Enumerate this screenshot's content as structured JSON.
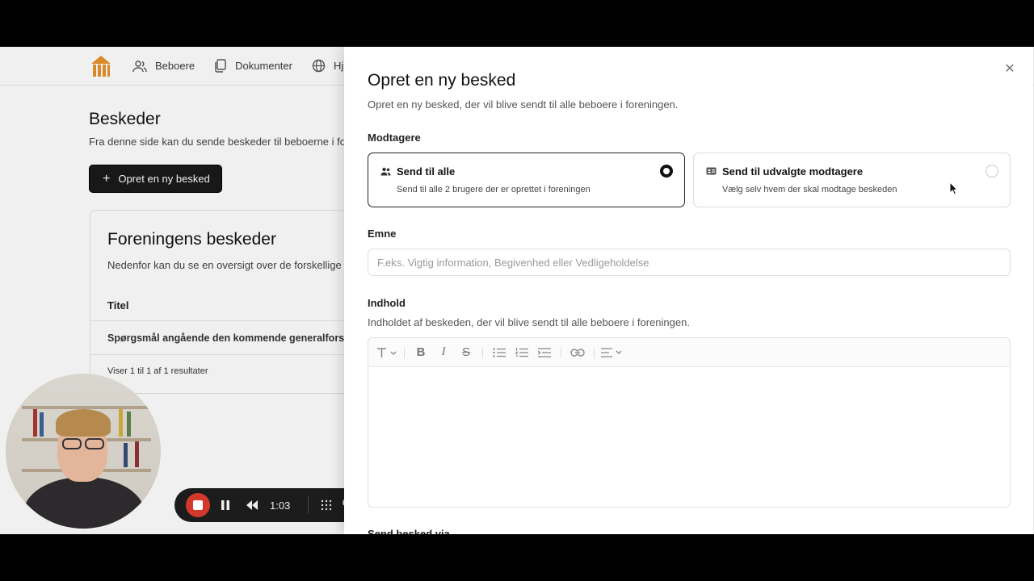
{
  "nav": {
    "items": [
      {
        "label": "Beboere",
        "icon": "users-icon"
      },
      {
        "label": "Dokumenter",
        "icon": "documents-icon"
      },
      {
        "label": "Hj",
        "icon": "globe-icon"
      }
    ]
  },
  "page": {
    "title": "Beskeder",
    "subtitle": "Fra denne side kan du sende beskeder til beboerne i fo",
    "create_button": "Opret en ny besked"
  },
  "messages_card": {
    "title": "Foreningens beskeder",
    "subtitle": "Nedenfor kan du se en oversigt over de forskellige",
    "column_title": "Titel",
    "rows": [
      "Spørgsmål angående den kommende generalforsa"
    ],
    "pagination": "Viser 1 til 1 af 1 resultater"
  },
  "recorder": {
    "time": "1:03"
  },
  "drawer": {
    "title": "Opret en ny besked",
    "subtitle": "Opret en ny besked, der vil blive sendt til alle beboere i foreningen.",
    "recipients_label": "Modtagere",
    "recipient_options": [
      {
        "title": "Send til alle",
        "description": "Send til alle 2 brugere der er oprettet i foreningen",
        "selected": true
      },
      {
        "title": "Send til udvalgte modtagere",
        "description": "Vælg selv hvem der skal modtage beskeden",
        "selected": false
      }
    ],
    "subject_label": "Emne",
    "subject_placeholder": "F.eks. Vigtig information, Begivenhed eller Vedligeholdelse",
    "subject_value": "",
    "content_label": "Indhold",
    "content_help": "Indholdet af beskeden, der vil blive sendt til alle beboere i foreningen.",
    "send_via_label": "Send besked via"
  },
  "colors": {
    "accent": "#1a1a1a",
    "logo": "#e8912c",
    "record": "#d2392b"
  }
}
